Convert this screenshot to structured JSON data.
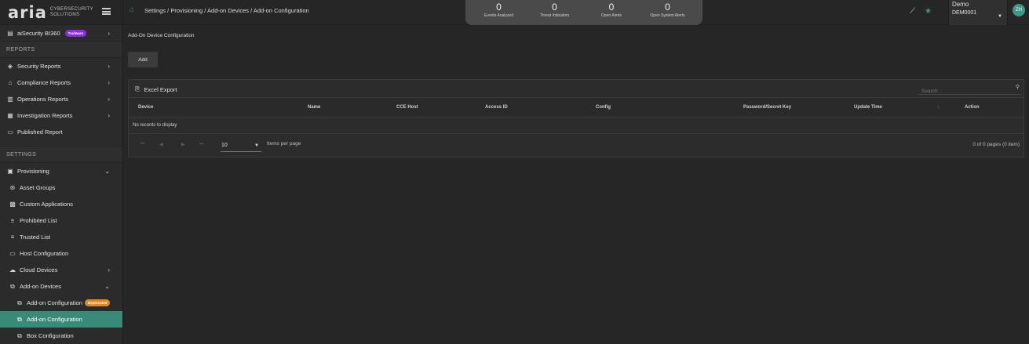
{
  "brand": {
    "name": "aria",
    "sub_line1": "CYBERSECURITY",
    "sub_line2": "SOLUTIONS"
  },
  "breadcrumb": "Settings / Provisioning / Add-on Devices / Add-on Configuration",
  "stats": [
    {
      "value": "0",
      "label": "Events Analyzed"
    },
    {
      "value": "0",
      "label": "Threat Indicators"
    },
    {
      "value": "0",
      "label": "Open Alerts"
    },
    {
      "value": "0",
      "label": "Open System Alerts"
    }
  ],
  "tenant": {
    "name": "Demo",
    "id": "DEM0001"
  },
  "user": {
    "initials": "ZH"
  },
  "sidebar": {
    "top_item": {
      "label": "aiSecurity BI360",
      "badge": "Trailware"
    },
    "reports_label": "REPORTS",
    "reports": [
      {
        "label": "Security Reports"
      },
      {
        "label": "Compliance Reports"
      },
      {
        "label": "Operations Reports"
      },
      {
        "label": "Investigation Reports"
      },
      {
        "label": "Published Report"
      }
    ],
    "settings_label": "SETTINGS",
    "provisioning": "Provisioning",
    "prov_items": [
      {
        "label": "Asset Groups"
      },
      {
        "label": "Custom Applications"
      },
      {
        "label": "Prohibited List"
      },
      {
        "label": "Trusted List"
      },
      {
        "label": "Host Configuration"
      },
      {
        "label": "Cloud Devices"
      },
      {
        "label": "Add-on Devices"
      }
    ],
    "addon_items": [
      {
        "label": "Add-on Configuration",
        "badge": "Deprecated"
      },
      {
        "label": "Add-on Configuration"
      },
      {
        "label": "Box Configuration"
      }
    ]
  },
  "main": {
    "title": "Add-On Device Configuration",
    "add_label": "Add",
    "excel_label": "Excel Export",
    "search_placeholder": "Search",
    "columns": [
      "Device",
      "Name",
      "CCE Host",
      "Access ID",
      "Config",
      "Password/Secret Key",
      "Update Time",
      "Action"
    ],
    "empty_text": "No records to display",
    "page_size": "10",
    "items_per_page": "Items per page",
    "page_info": "0 of 0 pages (0 item)"
  },
  "colors": {
    "accent": "#3a8a7a",
    "purple_badge": "#8a2be2",
    "orange_badge": "#e08a1e"
  }
}
